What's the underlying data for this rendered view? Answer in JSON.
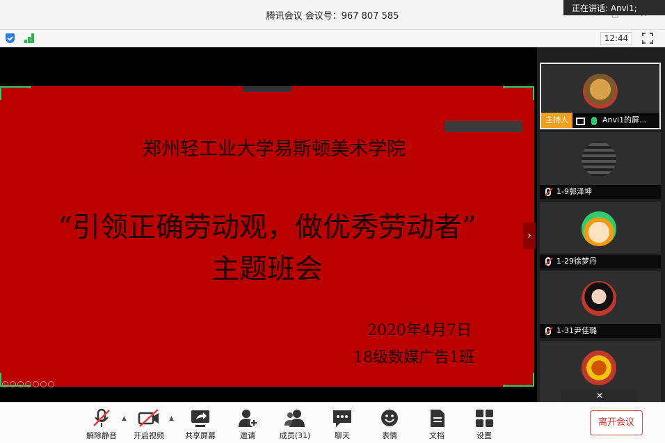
{
  "window": {
    "title": "腾讯会议 会议号：967 807 585",
    "speaking": "正在讲话: Anvi1;"
  },
  "statusbar": {
    "clock": "12:44",
    "security_icon": "shield-icon",
    "signal_icon": "signal-icon"
  },
  "slide": {
    "school": "郑州轻工业大学易斯顿美术学院",
    "theme_line1": "“引领正确劳动观，做优秀劳动者”",
    "theme_line2": "主题班会",
    "date": "2020年4月7日",
    "class_name": "18级数媒广告1班",
    "accent_color": "#bb0000"
  },
  "participants": {
    "host_badge": "主持人",
    "host_name": "Anvi1的屏…",
    "others": [
      {
        "name": "1-9郭泽坤"
      },
      {
        "name": "1-29徐梦丹"
      },
      {
        "name": "1-31尹佳璐"
      }
    ]
  },
  "toolbar": {
    "mute": "解除静音",
    "video": "开启视频",
    "share": "共享屏幕",
    "invite": "邀请",
    "members": "成员(31)",
    "chat": "聊天",
    "reaction": "表情",
    "docs": "文档",
    "settings": "设置",
    "leave": "离开会议"
  }
}
